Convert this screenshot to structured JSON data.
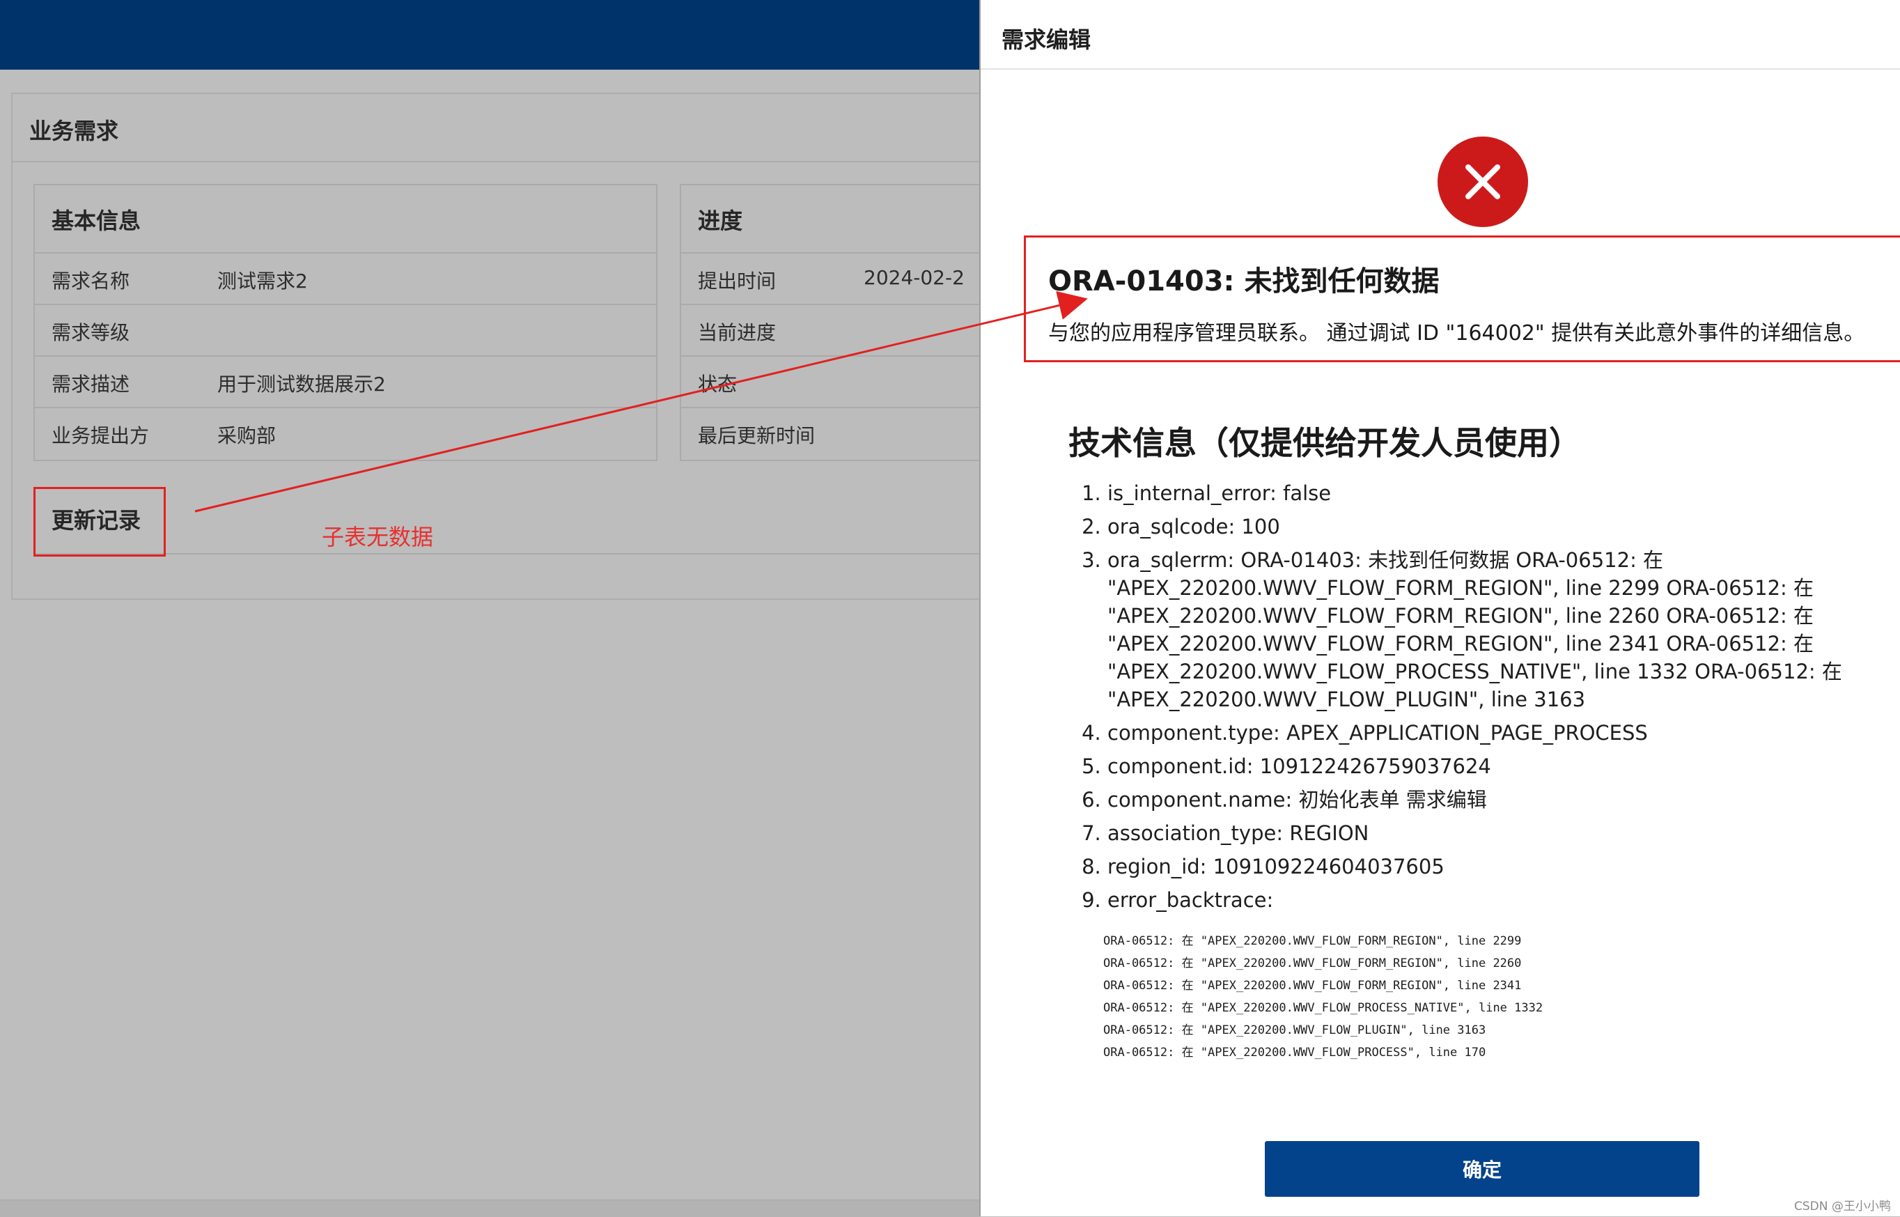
{
  "app": {},
  "main": {
    "region_title": "业务需求",
    "basic_info": {
      "title": "基本信息",
      "rows": [
        {
          "label": "需求名称",
          "value": "测试需求2"
        },
        {
          "label": "需求等级",
          "value": ""
        },
        {
          "label": "需求描述",
          "value": "用于测试数据展示2"
        },
        {
          "label": "业务提出方",
          "value": "采购部"
        }
      ]
    },
    "progress": {
      "title": "进度",
      "rows": [
        {
          "label": "提出时间",
          "value": "2024-02-2"
        },
        {
          "label": "当前进度",
          "value": ""
        },
        {
          "label": "状态",
          "value": ""
        },
        {
          "label": "最后更新时间",
          "value": ""
        }
      ]
    },
    "update_records": {
      "title": "更新记录"
    },
    "annotation": "子表无数据"
  },
  "dialog": {
    "title": "需求编辑",
    "error": {
      "code_title": "ORA-01403: 未找到任何数据",
      "message": "与您的应用程序管理员联系。 通过调试 ID \"164002\" 提供有关此意外事件的详细信息。"
    },
    "tech_info": {
      "title": "技术信息（仅提供给开发人员使用）",
      "items": [
        {
          "text": "is_internal_error: false"
        },
        {
          "text": "ora_sqlcode: 100"
        },
        {
          "lines": [
            "ora_sqlerrm: ORA-01403: 未找到任何数据 ORA-06512: 在",
            "\"APEX_220200.WWV_FLOW_FORM_REGION\", line 2299 ORA-06512: 在",
            "\"APEX_220200.WWV_FLOW_FORM_REGION\", line 2260 ORA-06512: 在",
            "\"APEX_220200.WWV_FLOW_FORM_REGION\", line 2341 ORA-06512: 在",
            "\"APEX_220200.WWV_FLOW_PROCESS_NATIVE\", line 1332 ORA-06512: 在",
            "\"APEX_220200.WWV_FLOW_PLUGIN\", line 3163"
          ]
        },
        {
          "text": "component.type: APEX_APPLICATION_PAGE_PROCESS"
        },
        {
          "text": "component.id: 109122426759037624"
        },
        {
          "text": "component.name: 初始化表单 需求编辑"
        },
        {
          "text": "association_type: REGION"
        },
        {
          "text": "region_id: 109109224604037605"
        },
        {
          "text": "error_backtrace:"
        }
      ],
      "backtrace": [
        "ORA-06512: 在 \"APEX_220200.WWV_FLOW_FORM_REGION\", line 2299",
        "ORA-06512: 在 \"APEX_220200.WWV_FLOW_FORM_REGION\", line 2260",
        "ORA-06512: 在 \"APEX_220200.WWV_FLOW_FORM_REGION\", line 2341",
        "ORA-06512: 在 \"APEX_220200.WWV_FLOW_PROCESS_NATIVE\", line 1332",
        "ORA-06512: 在 \"APEX_220200.WWV_FLOW_PLUGIN\", line 3163",
        "ORA-06512: 在 \"APEX_220200.WWV_FLOW_PROCESS\", line 170"
      ]
    },
    "ok_label": "确定"
  },
  "watermark": "CSDN @王小小鸭",
  "colors": {
    "header_bar": "#003369",
    "error_red": "#cc1a1a",
    "annotation_red": "#e32020",
    "button_blue": "#03438c"
  },
  "icons": {
    "error": "close-x-circle-icon"
  }
}
